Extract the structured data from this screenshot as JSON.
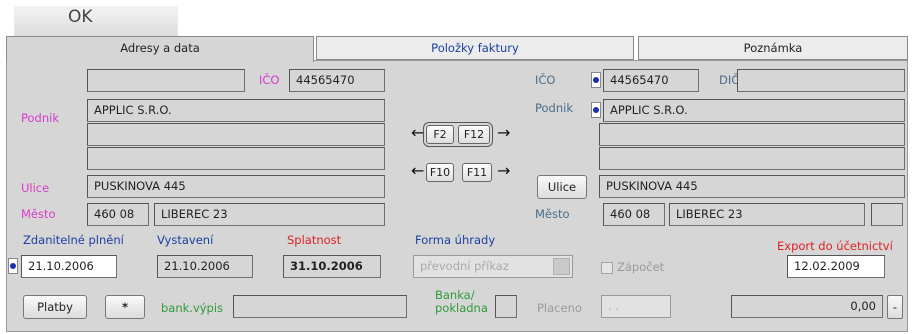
{
  "ok_button": "OK",
  "tabs": [
    "Adresy a data",
    "Položky faktury",
    "Poznámka"
  ],
  "left": {
    "ico_label": "IČO",
    "ico_value": "44565470",
    "podnik_label": "Podnik",
    "podnik_value": "APPLIC S.R.O.",
    "ulice_label": "Ulice",
    "ulice_value": "PUSKINOVA 445",
    "mesto_label": "Město",
    "psc_value": "460 08",
    "mesto_value": "LIBEREC 23"
  },
  "fkeys": [
    "F2",
    "F12",
    "F10",
    "F11"
  ],
  "right": {
    "ico_label": "IČO",
    "ico_value": "44565470",
    "dic_label": "DIČ",
    "podnik_label": "Podnik",
    "podnik_value": "APPLIC S.R.O.",
    "ulice_button": "Ulice",
    "ulice_value": "PUSKINOVA 445",
    "mesto_label": "Město",
    "psc_value": "460 08",
    "mesto_value": "LIBEREC 23"
  },
  "dates": {
    "zdanitelne_label": "Zdanitelné plnění",
    "zdanitelne_value": "21.10.2006",
    "vystaveni_label": "Vystavení",
    "vystaveni_value": "21.10.2006",
    "splatnost_label": "Splatnost",
    "splatnost_value": "31.10.2006"
  },
  "forma_uhrady": {
    "label": "Forma úhrady",
    "value": "převodní příkaz"
  },
  "zapocet_label": "Zápočet",
  "export": {
    "label": "Export do účetnictví",
    "value": "12.02.2009"
  },
  "bottom": {
    "platby_button": "Platby",
    "star_button": "*",
    "bank_vypis_label": "bank.výpis",
    "banka_label_1": "Banka/",
    "banka_label_2": "pokladna",
    "placeno_label": "Placeno",
    "placeno_value": ". .",
    "amount_value": "0,00",
    "minus_button": "-"
  }
}
